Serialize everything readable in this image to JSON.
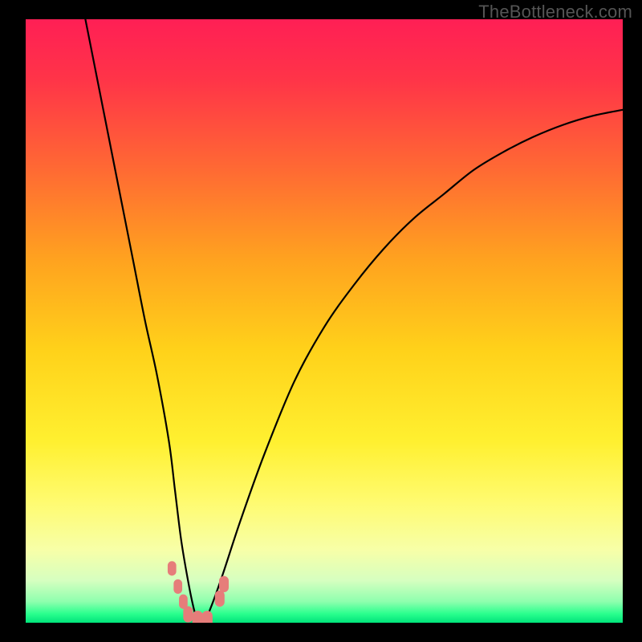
{
  "watermark": "TheBottleneck.com",
  "colors": {
    "black": "#000000",
    "curve": "#000000",
    "marker": "#e67d7a",
    "gradient_stops": [
      {
        "offset": 0.0,
        "color": "#ff1f55"
      },
      {
        "offset": 0.1,
        "color": "#ff3448"
      },
      {
        "offset": 0.25,
        "color": "#ff6a33"
      },
      {
        "offset": 0.4,
        "color": "#ffa31f"
      },
      {
        "offset": 0.55,
        "color": "#ffd21a"
      },
      {
        "offset": 0.7,
        "color": "#fff030"
      },
      {
        "offset": 0.8,
        "color": "#fffb70"
      },
      {
        "offset": 0.88,
        "color": "#f7ffa8"
      },
      {
        "offset": 0.93,
        "color": "#d6ffc0"
      },
      {
        "offset": 0.965,
        "color": "#8effae"
      },
      {
        "offset": 0.985,
        "color": "#2bff8e"
      },
      {
        "offset": 1.0,
        "color": "#00e37a"
      }
    ]
  },
  "chart_data": {
    "type": "line",
    "title": "",
    "xlabel": "",
    "ylabel": "",
    "xlim": [
      0,
      100
    ],
    "ylim": [
      0,
      100
    ],
    "grid": false,
    "series": [
      {
        "name": "bottleneck-curve",
        "x": [
          10,
          12,
          14,
          16,
          18,
          20,
          22,
          24,
          25,
          26,
          27,
          28,
          28.8,
          30,
          31,
          33,
          36,
          40,
          45,
          50,
          55,
          60,
          65,
          70,
          75,
          80,
          85,
          90,
          95,
          100
        ],
        "y": [
          100,
          90,
          80,
          70,
          60,
          50,
          41,
          30,
          22,
          14,
          8,
          3,
          0.5,
          0.5,
          2.5,
          8,
          17,
          28,
          40,
          49,
          56,
          62,
          67,
          71,
          75,
          78,
          80.5,
          82.5,
          84,
          85
        ]
      }
    ],
    "markers": [
      {
        "x": 24.5,
        "y": 9.0,
        "r": 1.6
      },
      {
        "x": 25.5,
        "y": 6.0,
        "r": 1.6
      },
      {
        "x": 26.4,
        "y": 3.5,
        "r": 1.6
      },
      {
        "x": 27.2,
        "y": 1.4,
        "r": 1.8
      },
      {
        "x": 28.8,
        "y": 0.5,
        "r": 2.0
      },
      {
        "x": 30.4,
        "y": 0.5,
        "r": 2.0
      },
      {
        "x": 32.5,
        "y": 4.0,
        "r": 1.8
      },
      {
        "x": 33.2,
        "y": 6.4,
        "r": 1.8
      }
    ]
  }
}
